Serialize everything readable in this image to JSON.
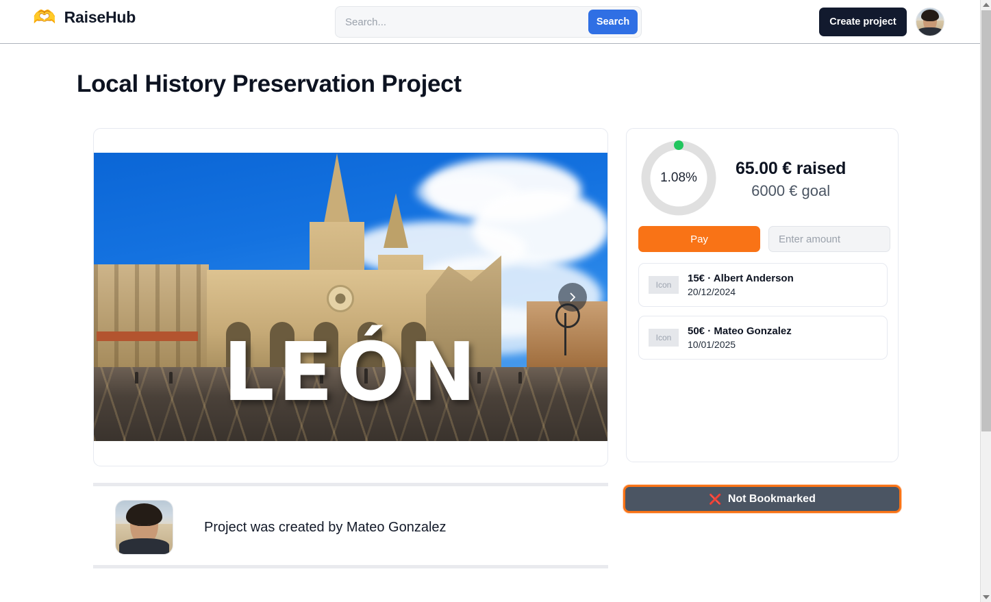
{
  "header": {
    "brand_logo_icon": "heart-in-hand-icon",
    "brand_logo_glyph": "🫶",
    "brand_name": "RaiseHub",
    "search": {
      "value": "",
      "placeholder": "Search...",
      "button_label": "Search"
    },
    "create_project_label": "Create project",
    "avatar_name": "user-avatar"
  },
  "page": {
    "title": "Local History Preservation Project"
  },
  "carousel": {
    "image_caption": "LEÓN",
    "next_label": "›"
  },
  "donation": {
    "percent_label": "1.08%",
    "percent_value": 1.08,
    "raised_label": "65.00 € raised",
    "goal_label": "6000 € goal",
    "pay_label": "Pay",
    "amount_value": "",
    "amount_placeholder": "Enter amount",
    "items": [
      {
        "icon_label": "Icon",
        "title": "15€ · Albert Anderson",
        "date": "20/12/2024"
      },
      {
        "icon_label": "Icon",
        "title": "50€ · Mateo Gonzalez",
        "date": "10/01/2025"
      }
    ]
  },
  "bookmark": {
    "icon_glyph": "❌",
    "label": "Not Bookmarked"
  },
  "creator": {
    "text": "Project was created by Mateo Gonzalez"
  },
  "colors": {
    "accent_orange": "#f97316",
    "brand_blue": "#2f6fe4",
    "dark_navy": "#121a2e",
    "progress_green": "#22c55e",
    "ring_track": "#e0e0e0",
    "bookmark_bg": "#4b5563"
  },
  "scrollbar": {
    "up_arrow": "scroll-up-arrow",
    "down_arrow": "scroll-down-arrow"
  }
}
